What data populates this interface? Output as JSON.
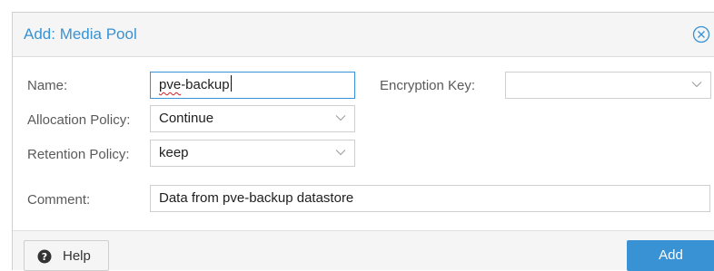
{
  "dialog": {
    "title": "Add: Media Pool",
    "close_icon": "close-circle-icon"
  },
  "form": {
    "name": {
      "label": "Name:",
      "value_underlined": "pve",
      "value_rest": "-backup"
    },
    "encryption_key": {
      "label": "Encryption Key:",
      "value": ""
    },
    "allocation_policy": {
      "label": "Allocation Policy:",
      "value": "Continue"
    },
    "retention_policy": {
      "label": "Retention Policy:",
      "value": "keep"
    },
    "comment": {
      "label": "Comment:",
      "value": "Data from pve-backup datastore"
    }
  },
  "footer": {
    "help_label": "Help",
    "help_icon": "question-circle-icon",
    "add_label": "Add"
  },
  "colors": {
    "accent": "#3892d4",
    "header_bg": "#f5f5f5"
  }
}
